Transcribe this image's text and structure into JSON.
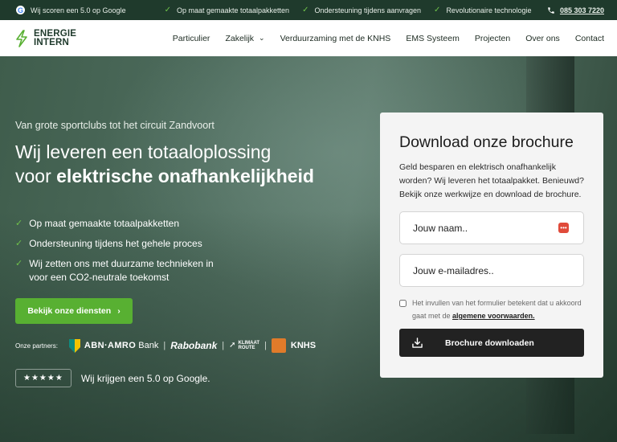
{
  "topbar": {
    "google_rating": "Wij scoren een 5.0 op Google",
    "features": [
      "Op maat gemaakte totaalpakketten",
      "Ondersteuning tijdens aanvragen",
      "Revolutionaire technologie"
    ],
    "phone": "085 303 7220"
  },
  "nav": {
    "logo_line1": "ENERGIE",
    "logo_line2": "INTERN",
    "menu": [
      "Particulier",
      "Zakelijk",
      "Verduurzaming met de KNHS",
      "EMS Systeem",
      "Projecten",
      "Over ons",
      "Contact"
    ]
  },
  "hero": {
    "kicker": "Van grote sportclubs tot het circuit Zandvoort",
    "headline_line1": "Wij leveren een totaaloplossing",
    "headline_line2_pre": "voor ",
    "headline_line2_bold": "elektrische onafhankelijkheid",
    "features": [
      "Op maat gemaakte totaalpakketten",
      "Ondersteuning tijdens het gehele proces",
      "Wij zetten ons met duurzame technieken in voor een CO2-neutrale toekomst"
    ],
    "cta": "Bekijk onze diensten",
    "partners_label": "Onze partners:",
    "partners": {
      "abn_bold": "ABN·AMRO",
      "abn_rest": "Bank",
      "rabo": "Rabobank",
      "klimaat_line1": "KLIMAAT",
      "klimaat_line2": "ROUTE",
      "knhs": "KNHS"
    },
    "stars": "★★★★★",
    "rating_text": "Wij krijgen een 5.0 op Google."
  },
  "brochure": {
    "title": "Download onze brochure",
    "text": "Geld besparen en elektrisch onafhankelijk worden? Wij leveren het totaalpakket. Benieuwd? Bekijk onze werkwijze en download de brochure.",
    "name_placeholder": "Jouw naam..",
    "email_placeholder": "Jouw e-mailadres..",
    "consent_text": "Het invullen van het formulier betekent dat u akkoord gaat met de ",
    "consent_link": "algemene voorwaarden.",
    "button": "Brochure downloaden"
  },
  "colors": {
    "brand_dark": "#1f3a2c",
    "accent_green": "#58b032",
    "check_green": "#6fc24a"
  }
}
